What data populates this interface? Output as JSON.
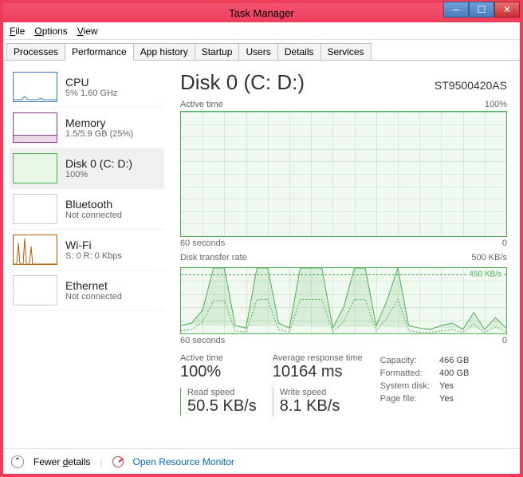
{
  "window": {
    "title": "Task Manager"
  },
  "menu": {
    "file": "File",
    "options": "Options",
    "view": "View"
  },
  "tabs": [
    "Processes",
    "Performance",
    "App history",
    "Startup",
    "Users",
    "Details",
    "Services"
  ],
  "active_tab": 1,
  "sidebar": [
    {
      "name": "CPU",
      "sub": "5% 1.60 GHz",
      "kind": "cpu"
    },
    {
      "name": "Memory",
      "sub": "1.5/5.9 GB (25%)",
      "kind": "mem"
    },
    {
      "name": "Disk 0 (C: D:)",
      "sub": "100%",
      "kind": "disk",
      "selected": true
    },
    {
      "name": "Bluetooth",
      "sub": "Not connected",
      "kind": "blank"
    },
    {
      "name": "Wi-Fi",
      "sub": "S: 0 R: 0 Kbps",
      "kind": "wifi"
    },
    {
      "name": "Ethernet",
      "sub": "Not connected",
      "kind": "blank"
    }
  ],
  "main": {
    "title": "Disk 0 (C: D:)",
    "model": "ST9500420AS",
    "chart1": {
      "label_left": "Active time",
      "label_right": "100%",
      "axis_left": "60 seconds",
      "axis_right": "0"
    },
    "chart2": {
      "label_left": "Disk transfer rate",
      "label_right": "500 KB/s",
      "dotted_label": "450 KB/s",
      "axis_left": "60 seconds",
      "axis_right": "0"
    },
    "stats": {
      "active_time": {
        "label": "Active time",
        "value": "100%"
      },
      "avg_response": {
        "label": "Average response time",
        "value": "10164 ms"
      },
      "read_speed": {
        "label": "Read speed",
        "value": "50.5 KB/s"
      },
      "write_speed": {
        "label": "Write speed",
        "value": "8.1 KB/s"
      },
      "kv": [
        {
          "k": "Capacity:",
          "v": "466 GB"
        },
        {
          "k": "Formatted:",
          "v": "400 GB"
        },
        {
          "k": "System disk:",
          "v": "Yes"
        },
        {
          "k": "Page file:",
          "v": "Yes"
        }
      ]
    }
  },
  "footer": {
    "fewer": "Fewer details",
    "resmon": "Open Resource Monitor"
  },
  "chart_data": [
    {
      "type": "line",
      "title": "Active time",
      "xlabel": "seconds",
      "ylabel": "%",
      "xlim": [
        0,
        60
      ],
      "ylim": [
        0,
        100
      ],
      "x": [
        60,
        55,
        50,
        45,
        40,
        35,
        30,
        25,
        20,
        15,
        10,
        5,
        0
      ],
      "values": [
        100,
        100,
        100,
        100,
        100,
        100,
        100,
        100,
        100,
        100,
        100,
        100,
        100
      ]
    },
    {
      "type": "line",
      "title": "Disk transfer rate",
      "xlabel": "seconds",
      "ylabel": "KB/s",
      "xlim": [
        0,
        60
      ],
      "ylim": [
        0,
        500
      ],
      "reference_line": 450,
      "series": [
        {
          "name": "Read",
          "x": [
            60,
            58,
            56,
            54,
            52,
            50,
            48,
            46,
            44,
            42,
            40,
            38,
            36,
            34,
            32,
            30,
            28,
            26,
            24,
            22,
            20,
            18,
            16,
            14,
            12,
            10,
            8,
            6,
            4,
            2,
            0
          ],
          "values": [
            60,
            80,
            180,
            500,
            500,
            60,
            40,
            500,
            500,
            80,
            40,
            500,
            500,
            500,
            40,
            200,
            500,
            500,
            60,
            250,
            500,
            60,
            40,
            30,
            60,
            80,
            30,
            160,
            30,
            120,
            40
          ]
        },
        {
          "name": "Write",
          "x": [
            60,
            58,
            56,
            54,
            52,
            50,
            48,
            46,
            44,
            42,
            40,
            38,
            36,
            34,
            32,
            30,
            28,
            26,
            24,
            22,
            20,
            18,
            16,
            14,
            12,
            10,
            8,
            6,
            4,
            2,
            0
          ],
          "values": [
            20,
            30,
            90,
            250,
            250,
            20,
            10,
            260,
            260,
            30,
            10,
            260,
            260,
            260,
            10,
            90,
            260,
            260,
            20,
            120,
            260,
            20,
            10,
            8,
            20,
            30,
            8,
            70,
            8,
            50,
            10
          ]
        }
      ]
    }
  ]
}
